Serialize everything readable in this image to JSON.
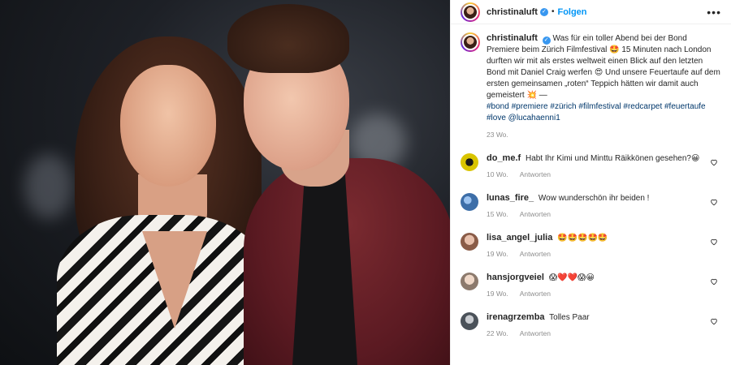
{
  "header": {
    "username": "christinaluft",
    "follow_label": "Folgen",
    "more_label": "•••"
  },
  "caption": {
    "username": "christinaluft",
    "text": "Was für ein toller Abend bei der Bond Premiere beim Zürich Filmfestival 🤩 15 Minuten nach London durften wir mit als erstes weltweit einen Blick auf den letzten Bond mit Daniel Craig werfen 😍 Und unsere Feuertaufe auf dem ersten gemeinsamen „roten“ Teppich hätten wir damit auch gemeistert 💥 —",
    "hashtags": "#bond #premiere #zürich #filmfestival #redcarpet #feuertaufe #love @lucahaenni1",
    "age": "23 Wo."
  },
  "comments": [
    {
      "username": "do_me.f",
      "text": "Habt Ihr Kimi und Minttu Räikkönen gesehen?😀",
      "age": "10 Wo.",
      "reply": "Antworten",
      "avatar_color": "#d9c400"
    },
    {
      "username": "lunas_fire_",
      "text": "Wow wunderschön ihr beiden !",
      "age": "15 Wo.",
      "reply": "Antworten",
      "avatar_color": "#3d6ea8"
    },
    {
      "username": "lisa_angel_julia",
      "text": "🤩🤩🤩🤩🤩",
      "age": "19 Wo.",
      "reply": "Antworten",
      "avatar_color": "#c79a86"
    },
    {
      "username": "hansjorgveiel",
      "text": "😱❤️❤️😱😀",
      "age": "19 Wo.",
      "reply": "Antworten",
      "avatar_color": "#b7a79a"
    },
    {
      "username": "irenagrzemba",
      "text": "Tolles Paar",
      "age": "22 Wo.",
      "reply": "Antworten",
      "avatar_color": "#6d747c"
    }
  ],
  "colors": {
    "link": "#0095f6",
    "hashtag": "#00376b",
    "muted": "#8e8e8e",
    "verified": "#3897f0"
  }
}
